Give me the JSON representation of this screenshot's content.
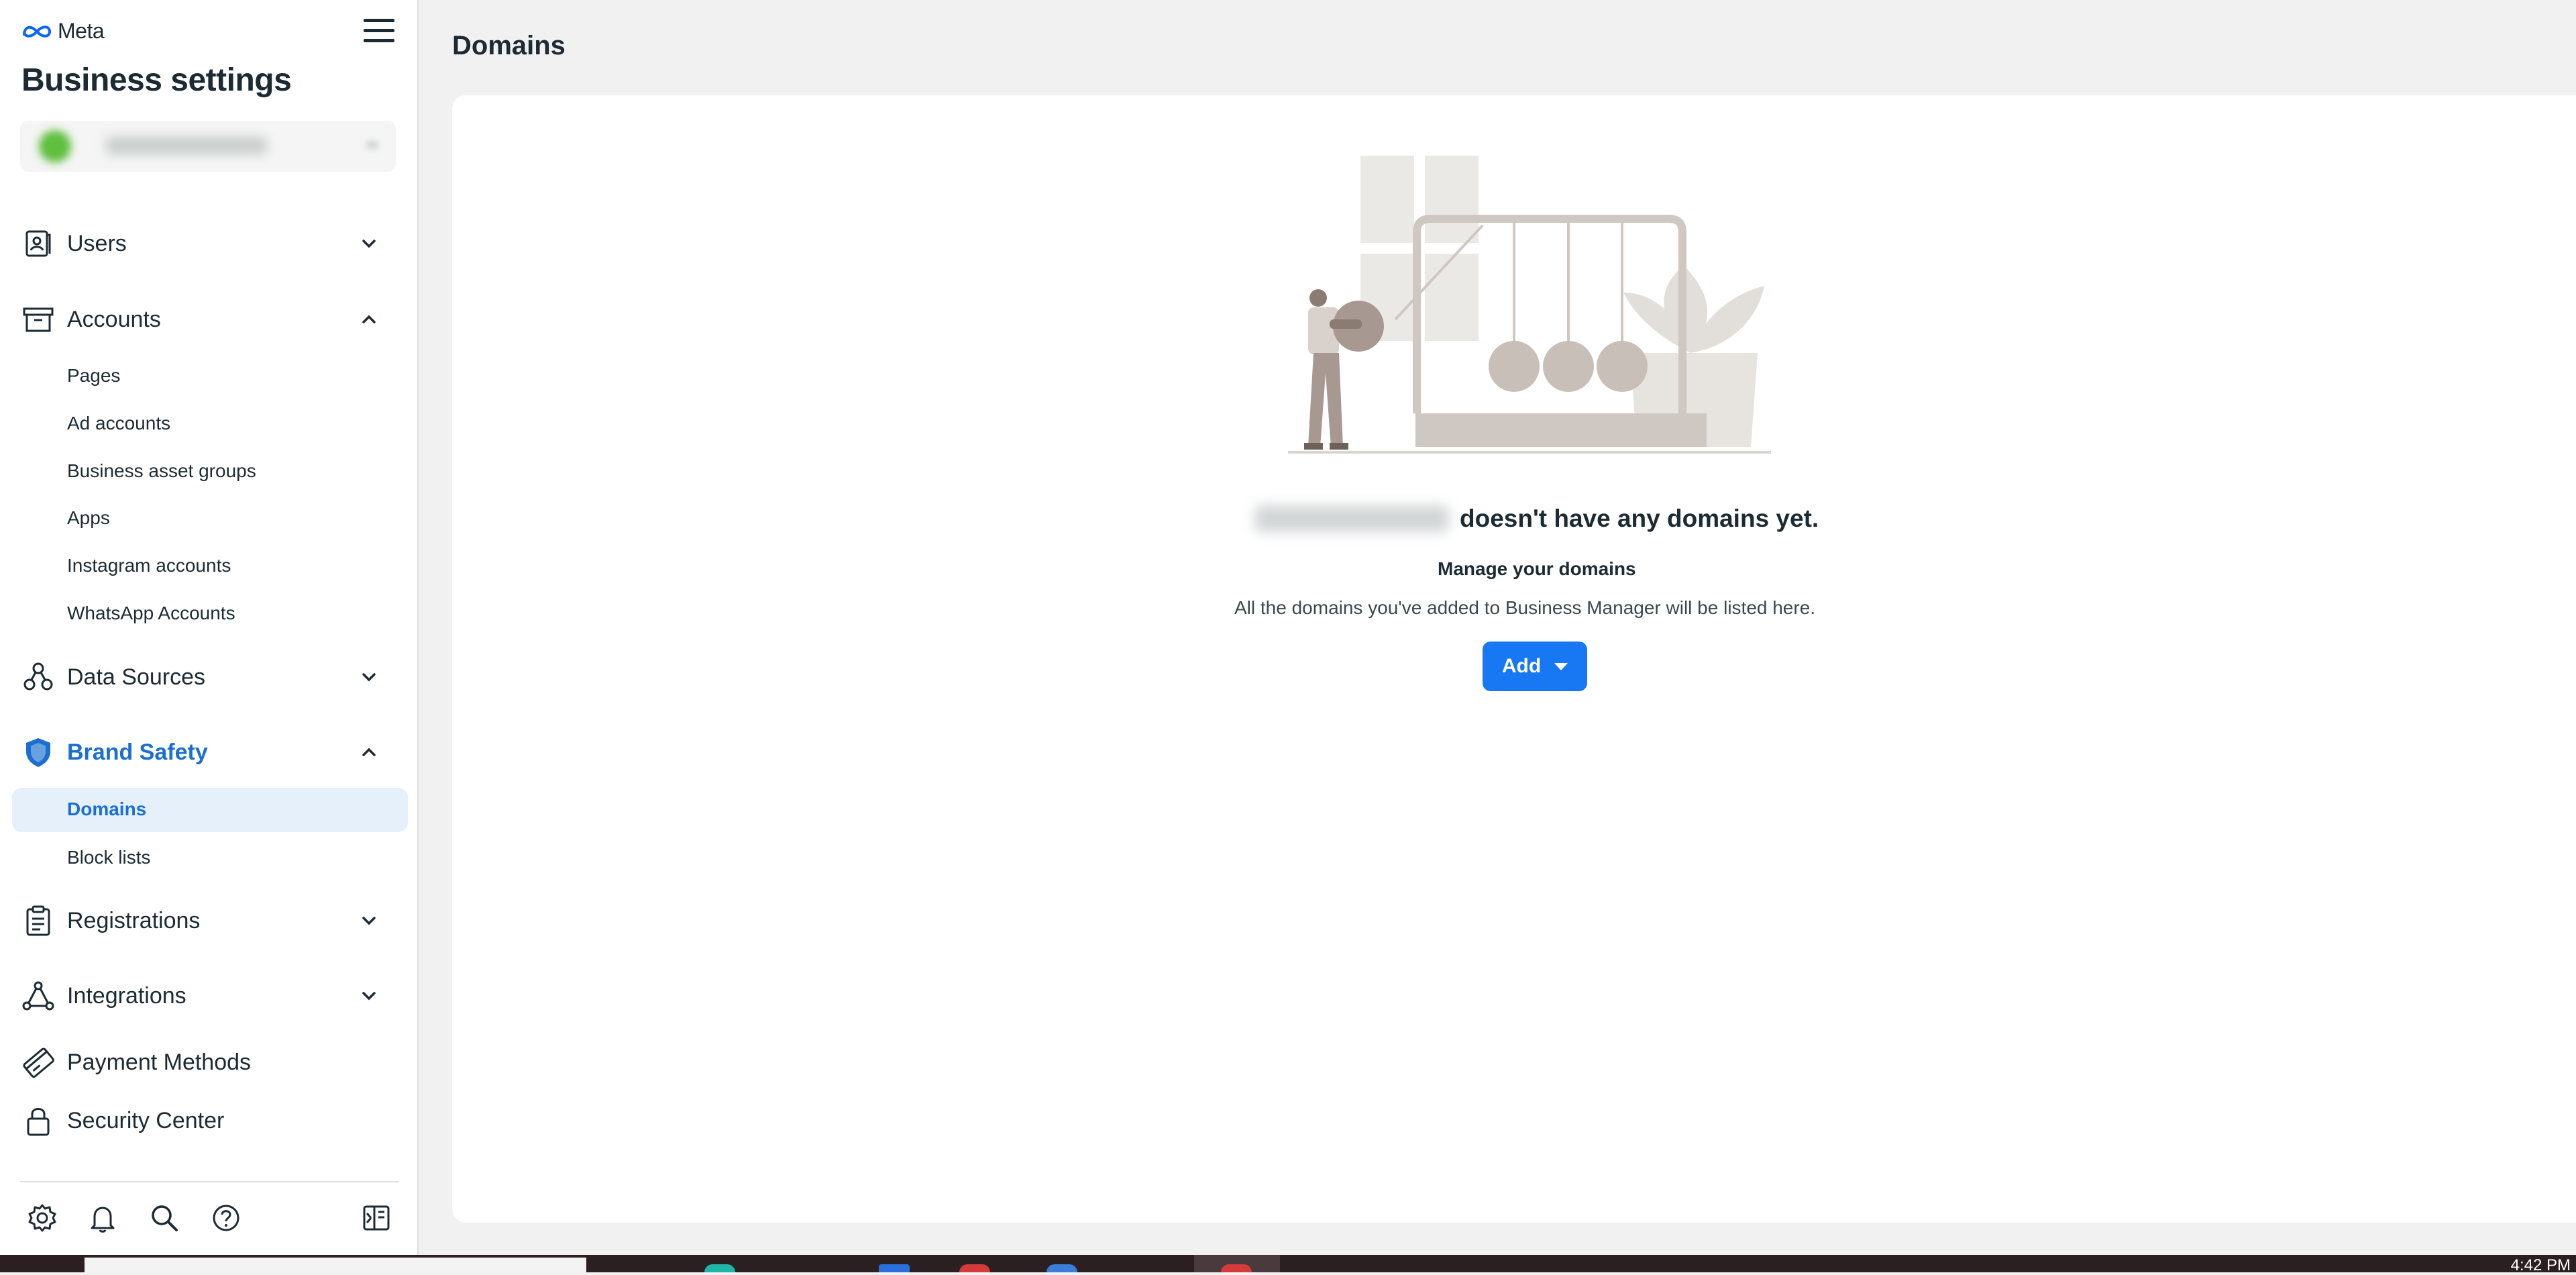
{
  "app": {
    "logo_text": "Meta",
    "title": "Business settings"
  },
  "sidebar": {
    "sections": {
      "users": "Users",
      "accounts": "Accounts",
      "data_sources": "Data Sources",
      "brand_safety": "Brand Safety",
      "registrations": "Registrations",
      "integrations": "Integrations",
      "payment_methods": "Payment Methods",
      "security_center": "Security Center"
    },
    "accounts_items": [
      "Pages",
      "Ad accounts",
      "Business asset groups",
      "Apps",
      "Instagram accounts",
      "WhatsApp Accounts"
    ],
    "brand_safety_items": [
      "Domains",
      "Block lists"
    ]
  },
  "main": {
    "page_title": "Domains",
    "empty_heading": "doesn't have any domains yet.",
    "empty_subheading": "Manage your domains",
    "empty_description": "All the domains you've added to Business Manager will be listed here.",
    "add_button": "Add"
  },
  "taskbar": {
    "clock": "4:42 PM"
  },
  "colors": {
    "accent": "#1877f2",
    "active_text": "#1a6fd0",
    "active_bg": "#e6f0fb"
  }
}
